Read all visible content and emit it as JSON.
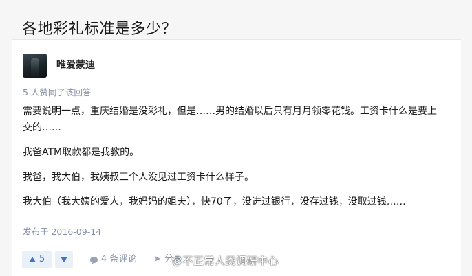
{
  "question": {
    "title": "各地彩礼标准是多少？"
  },
  "answer": {
    "author_name": "唯爱蒙迪",
    "vote_summary": "5 人赞同了该回答",
    "paragraphs": [
      "需要说明一点，重庆结婚是没彩礼，但是……男的结婚以后只有月月领零花钱。工资卡什么是要上交的……",
      "我爸ATM取款都是我教的。",
      "我爸，我大伯，我姨叔三个人没见过工资卡什么样子。",
      "我大伯（我大姨的爱人，我妈妈的姐夫），快70了，没进过银行，没存过钱，没取过钱……"
    ],
    "publish_time": "发布于 2016-09-14"
  },
  "actions": {
    "upvote_count": "5",
    "comments_label": "4 条评论",
    "share_label": "分享"
  },
  "watermark": "@不正常人类调研中心",
  "colors": {
    "accent": "#3e74c5",
    "accent_bg": "#eaf0f7",
    "muted": "#8590a6"
  },
  "icons": {
    "upvote": "triangle-up-icon",
    "downvote": "triangle-down-icon",
    "comment": "comment-bubble-icon",
    "share": "paper-plane-icon"
  }
}
